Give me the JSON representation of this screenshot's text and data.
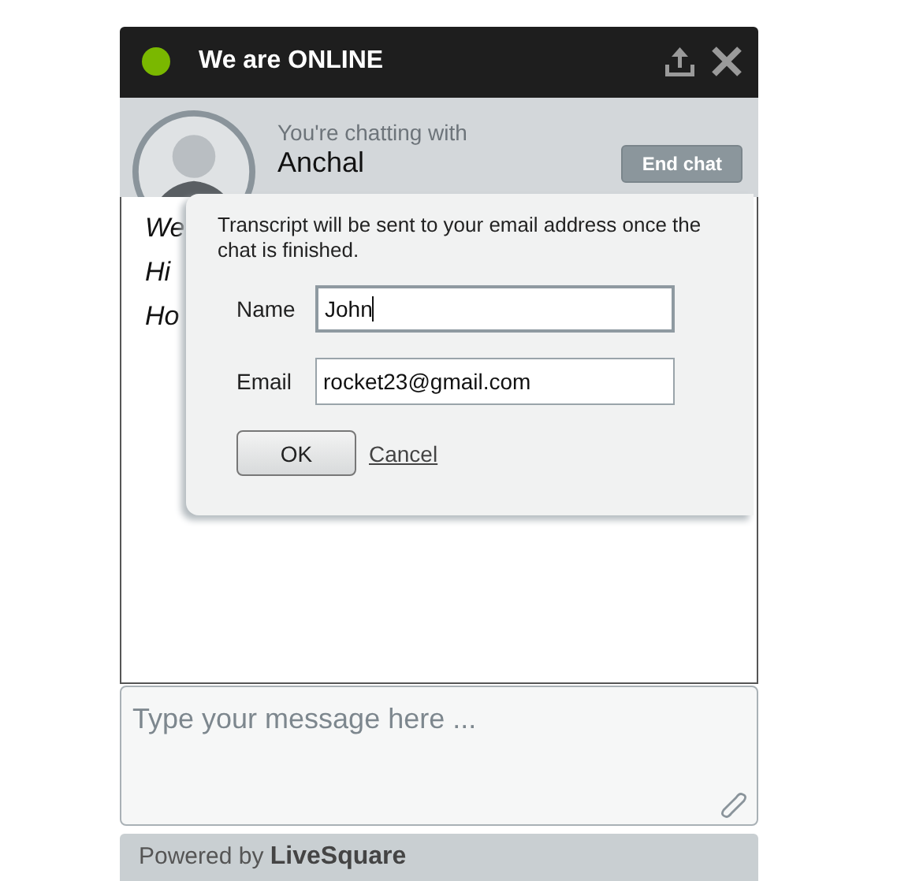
{
  "header": {
    "title": "We are ONLINE",
    "online": true
  },
  "contact": {
    "caption": "You're chatting with",
    "name": "Anchal",
    "end_button": "End chat"
  },
  "messages": [
    {
      "text": "We"
    },
    {
      "text": "Hi"
    },
    {
      "text": "Ho"
    }
  ],
  "transcript_dialog": {
    "message": "Transcript will be sent to your email address once the chat is finished.",
    "fields": [
      {
        "label": "Name",
        "value": "John",
        "focused": true
      },
      {
        "label": "Email",
        "value": "rocket23@gmail.com",
        "focused": false
      }
    ],
    "ok_button": "OK",
    "cancel_link": "Cancel"
  },
  "composer": {
    "placeholder": "Type your message here ..."
  },
  "footer": {
    "text": "Powered by **LiveSquare**"
  }
}
